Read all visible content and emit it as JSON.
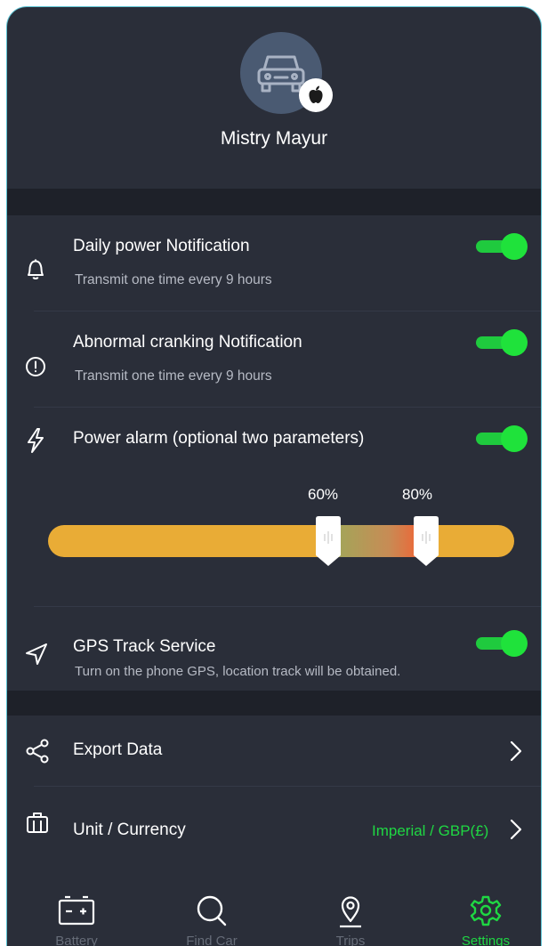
{
  "profile": {
    "name": "Mistry Mayur"
  },
  "settings": {
    "daily_power": {
      "title": "Daily power Notification",
      "subtitle": "Transmit one time every 9 hours",
      "enabled": true
    },
    "abnormal_cranking": {
      "title": "Abnormal cranking Notification",
      "subtitle": "Transmit one time every 9 hours",
      "enabled": true
    },
    "power_alarm": {
      "title": "Power alarm (optional two parameters)",
      "enabled": true,
      "low_label": "60%",
      "high_label": "80%",
      "low_value": 0.6,
      "high_value": 0.8
    },
    "gps_track": {
      "title": "GPS Track Service",
      "subtitle": "Turn on the phone GPS, location track will be obtained.",
      "enabled": true
    },
    "export_data": {
      "title": "Export Data"
    },
    "unit_currency": {
      "title": "Unit / Currency",
      "value": "Imperial / GBP(£)"
    }
  },
  "tabs": [
    {
      "label": "Battery",
      "icon": "battery-icon"
    },
    {
      "label": "Find Car",
      "icon": "search-icon"
    },
    {
      "label": "Trips",
      "icon": "map-pin-icon"
    },
    {
      "label": "Settings",
      "icon": "gear-icon",
      "active": true
    }
  ],
  "colors": {
    "accent": "#1fd743",
    "background": "#2a2e39",
    "slider": "#e9ac36"
  }
}
